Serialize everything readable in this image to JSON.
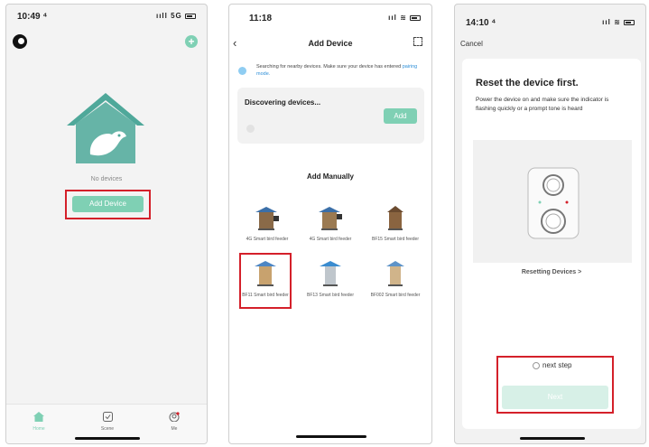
{
  "screen1": {
    "time": "10:49 ⁴",
    "signal": "ııll 5G",
    "empty_label": "No devices",
    "add_device_label": "Add Device",
    "tabs": [
      {
        "label": "Home",
        "icon": "home-icon"
      },
      {
        "label": "Scene",
        "icon": "scene-icon"
      },
      {
        "label": "Me",
        "icon": "profile-icon"
      }
    ]
  },
  "screen2": {
    "time": "11:18",
    "title": "Add Device",
    "search_text": "Searching for nearby devices. Make sure your device has entered ",
    "pairing_link": "pairing mode.",
    "discovering_label": "Discovering devices...",
    "add_button_label": "Add",
    "manual_heading": "Add Manually",
    "devices": [
      {
        "label": "4G Smart bird feeder"
      },
      {
        "label": "4G Smart bird feeder"
      },
      {
        "label": "BF15 Smart bird feeder"
      },
      {
        "label": "BF11 Smart bird feeder"
      },
      {
        "label": "BF13 Smart bird feeder"
      },
      {
        "label": "BF002 Smart bird feeder"
      }
    ]
  },
  "screen3": {
    "time": "14:10 ⁴",
    "cancel_label": "Cancel",
    "title": "Reset the device first.",
    "description": "Power the device on and make sure the indicator is flashing quickly or a prompt tone is heard",
    "resetting_link": "Resetting Devices >",
    "next_step_label": "next step",
    "next_button_label": "Next"
  },
  "colors": {
    "accent": "#7fd0b4",
    "highlight": "#d4202a",
    "roof": "#4fa89a",
    "link": "#2f8fd8"
  }
}
